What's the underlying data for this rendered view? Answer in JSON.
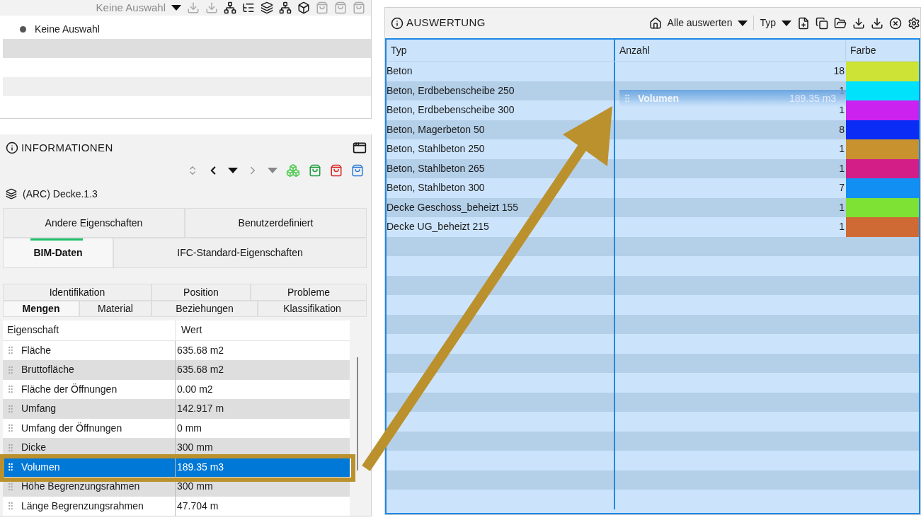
{
  "top_panel": {
    "dropdown": "Keine Auswahl",
    "list": [
      {
        "label": "Keine Auswahl"
      }
    ]
  },
  "info_panel": {
    "title": "INFORMATIONEN",
    "object": "(ARC) Decke.1.3",
    "tabs_row_1": [
      {
        "label": "Andere Eigenschaften",
        "selected": false
      },
      {
        "label": "Benutzerdefiniert",
        "selected": false
      }
    ],
    "tabs_row_2": [
      {
        "label": "BIM-Daten",
        "selected": true
      },
      {
        "label": "IFC-Standard-Eigenschaften",
        "selected": false
      }
    ],
    "subtabs_row_1": [
      {
        "label": "Identifikation",
        "selected": false
      },
      {
        "label": "Position",
        "selected": false
      },
      {
        "label": "Probleme",
        "selected": false
      }
    ],
    "subtabs_row_2": [
      {
        "label": "Mengen",
        "selected": true
      },
      {
        "label": "Material",
        "selected": false
      },
      {
        "label": "Beziehungen",
        "selected": false
      },
      {
        "label": "Klassifikation",
        "selected": false
      }
    ],
    "table": {
      "columns": [
        "Eigenschaft",
        "Wert"
      ],
      "rows": [
        {
          "name": "Fläche",
          "value": "635.68 m2",
          "selected": false
        },
        {
          "name": "Bruttofläche",
          "value": "635.68 m2",
          "selected": false
        },
        {
          "name": "Fläche der Öffnungen",
          "value": "0.00 m2",
          "selected": false
        },
        {
          "name": "Umfang",
          "value": "142.917 m",
          "selected": false
        },
        {
          "name": "Umfang der Öffnungen",
          "value": "0 mm",
          "selected": false
        },
        {
          "name": "Dicke",
          "value": "300 mm",
          "selected": false
        },
        {
          "name": "Volumen",
          "value": "189.35 m3",
          "selected": true
        },
        {
          "name": "Höhe Begrenzungsrahmen",
          "value": "300 mm",
          "selected": false
        },
        {
          "name": "Länge Begrenzungsrahmen",
          "value": "47.704 m",
          "selected": false
        }
      ]
    }
  },
  "eval_panel": {
    "title": "AUSWERTUNG",
    "evaluate_dropdown": "Alle auswerten",
    "group_dropdown": "Typ",
    "table": {
      "columns": [
        "Typ",
        "Anzahl",
        "Farbe"
      ],
      "rows": [
        {
          "type": "Beton",
          "count": "18",
          "color": "#cde335"
        },
        {
          "type": "Beton, Erdbebenscheibe 250",
          "count": "1",
          "color": "#00e2fb"
        },
        {
          "type": "Beton, Erdbebenscheibe 300",
          "count": "1",
          "color": "#cc22f0"
        },
        {
          "type": "Beton, Magerbeton 50",
          "count": "8",
          "color": "#0a2cf5"
        },
        {
          "type": "Beton, Stahlbeton 250",
          "count": "1",
          "color": "#c8922f"
        },
        {
          "type": "Beton, Stahlbeton 265",
          "count": "1",
          "color": "#d21e86"
        },
        {
          "type": "Beton, Stahlbeton 300",
          "count": "7",
          "color": "#128ff2"
        },
        {
          "type": "Decke Geschoss_beheizt 155",
          "count": "1",
          "color": "#7ee234"
        },
        {
          "type": "Decke UG_beheizt 215",
          "count": "1",
          "color": "#d06a35"
        }
      ]
    },
    "drag_ghost": {
      "name": "Volumen",
      "value": "189.35 m3"
    }
  }
}
